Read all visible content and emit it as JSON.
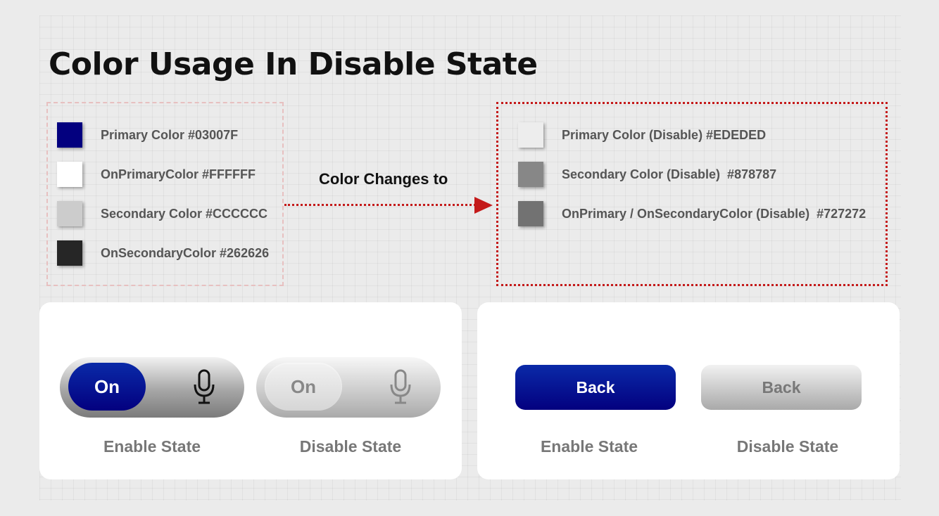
{
  "title": "Color Usage In Disable State",
  "arrow_label": "Color Changes to",
  "colors": {
    "primary": "#03007F",
    "on_primary": "#FFFFFF",
    "secondary": "#CCCCCC",
    "on_secondary": "#262626",
    "primary_disable": "#EDEDED",
    "secondary_disable": "#878787",
    "on_disable": "#727272",
    "accent_red": "#C41A1A"
  },
  "enabled_palette": [
    {
      "label": "Primary Color #03007F",
      "color": "#03007F"
    },
    {
      "label": "OnPrimaryColor #FFFFFF",
      "color": "#FFFFFF"
    },
    {
      "label": "Secondary Color #CCCCCC",
      "color": "#CCCCCC"
    },
    {
      "label": "OnSecondaryColor #262626",
      "color": "#262626"
    }
  ],
  "disabled_palette": [
    {
      "label": "Primary Color (Disable) #EDEDED",
      "color": "#EDEDED"
    },
    {
      "label": "Secondary Color (Disable)  #878787",
      "color": "#878787"
    },
    {
      "label": "OnPrimary / OnSecondaryColor (Disable)  #727272",
      "color": "#727272"
    }
  ],
  "toggle_card": {
    "enable": {
      "knob_label": "On",
      "icon": "microphone-icon",
      "state_label": "Enable State"
    },
    "disable": {
      "knob_label": "On",
      "icon": "microphone-icon",
      "state_label": "Disable State"
    }
  },
  "button_card": {
    "enable": {
      "label": "Back",
      "state_label": "Enable State"
    },
    "disable": {
      "label": "Back",
      "state_label": "Disable State"
    }
  }
}
